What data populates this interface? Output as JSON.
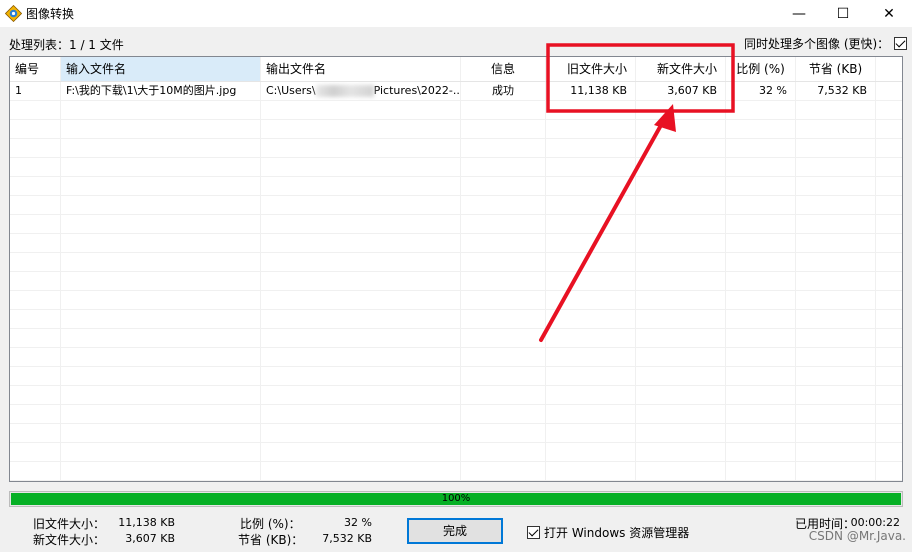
{
  "window": {
    "title": "图像转换",
    "icon": "app-icon",
    "minimize_glyph": "—",
    "maximize_glyph": "☐",
    "close_glyph": "✕"
  },
  "queue_label": "处理列表：1 / 1 文件",
  "multi_process": {
    "label": "同时处理多个图像 (更快)：",
    "checked": true
  },
  "table": {
    "columns": [
      "编号",
      "输入文件名",
      "输出文件名",
      "信息",
      "旧文件大小",
      "新文件大小",
      "比例 (%)",
      "节省 (KB)"
    ],
    "rows": [
      {
        "no": "1",
        "input": "F:\\我的下载\\1\\大于10M的图片.jpg",
        "output_prefix": "C:\\Users\\",
        "output_suffix": "Pictures\\2022-...",
        "info": "成功",
        "old_size": "11,138 KB",
        "new_size": "3,607 KB",
        "ratio": "32 %",
        "saved": "7,532 KB"
      }
    ]
  },
  "progress": {
    "percent": 100,
    "label": "100%"
  },
  "summary": {
    "old_size_label": "旧文件大小：",
    "old_size_value": "11,138 KB",
    "new_size_label": "新文件大小：",
    "new_size_value": "3,607 KB",
    "ratio_label": "比例 (%)：",
    "ratio_value": "32 %",
    "saved_label": "节省 (KB)：",
    "saved_value": "7,532 KB",
    "elapsed_label": "已用时间：",
    "elapsed_value": "00:00:22"
  },
  "done_button": "完成",
  "open_explorer": {
    "label": "打开 Windows 资源管理器",
    "checked": true
  },
  "watermark": "CSDN @Mr.Java.",
  "colors": {
    "highlight": "#e81123",
    "progress": "#06b025",
    "selected_header": "#d9ebf9"
  }
}
